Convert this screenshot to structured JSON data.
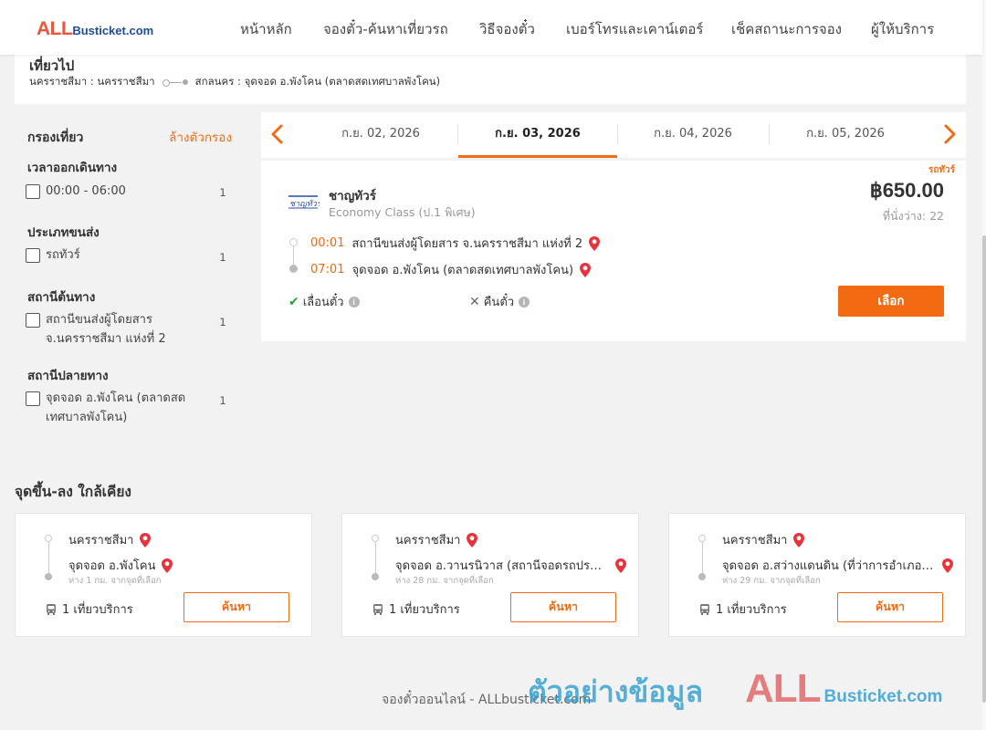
{
  "header": {
    "logo_all": "ALL",
    "logo_rest": "Busticket.com",
    "nav": [
      "หน้าหลัก",
      "จองตั๋ว-ค้นหาเที่ยวรถ",
      "วิธีจองตั๋ว",
      "เบอร์โทรและเคาน์เตอร์",
      "เช็คสถานะการจอง",
      "ผู้ให้บริการ"
    ]
  },
  "trip": {
    "title": "เที่ยวไป",
    "from": "นครราชสีมา : นครราชสีมา",
    "to": "สกลนคร : จุดจอด อ.พังโคน (ตลาดสดเทศบาลพังโคน)"
  },
  "filters": {
    "title": "กรองเที่ยว",
    "clear": "ล้างตัวกรอง",
    "groups": [
      {
        "title": "เวลาออกเดินทาง",
        "options": [
          {
            "label": "00:00 - 06:00",
            "count": "1",
            "checked": false
          }
        ]
      },
      {
        "title": "ประเภทขนส่ง",
        "options": [
          {
            "label": "รถทัวร์",
            "count": "1",
            "checked": false
          }
        ]
      },
      {
        "title": "สถานีต้นทาง",
        "options": [
          {
            "label": "สถานีขนส่งผู้โดยสาร จ.นครราชสีมา แห่งที่ 2",
            "count": "1",
            "checked": false
          }
        ]
      },
      {
        "title": "สถานีปลายทาง",
        "options": [
          {
            "label": "จุดจอด อ.พังโคน (ตลาดสดเทศบาลพังโคน)",
            "count": "1",
            "checked": false
          }
        ]
      }
    ]
  },
  "dates": {
    "tabs": [
      "ก.ย. 02, 2026",
      "ก.ย. 03, 2026",
      "ก.ย. 04, 2026",
      "ก.ย. 05, 2026"
    ],
    "active_index": 1
  },
  "result": {
    "tag": "รถทัวร์",
    "operator": "ชาญทัวร์",
    "class": "Economy Class (ป.1 พิเศษ)",
    "price": "฿650.00",
    "seats": "ที่นั่งว่าง: 22",
    "depart_time": "00:01",
    "depart_place": "สถานีขนส่งผู้โดยสาร จ.นครราชสีมา แห่งที่ 2",
    "arrive_time": "07:01",
    "arrive_place": "จุดจอด อ.พังโคน (ตลาดสดเทศบาลพังโคน)",
    "reschedule": "เลื่อนตั๋ว",
    "refund": "คืนตั๋ว",
    "select_label": "เลือก"
  },
  "nearby": {
    "title": "จุดขึ้น-ลง ใกล้เคียง",
    "cards": [
      {
        "from": "นครราชสีมา",
        "to": "จุดจอด อ.พังโคน",
        "distance": "ห่าง 1 กม. จากจุดที่เลือก",
        "trips": "1 เที่ยวบริการ",
        "button": "ค้นหา"
      },
      {
        "from": "นครราชสีมา",
        "to": "จุดจอด อ.วานรนิวาส (สถานีจอดรถประจำทาง)",
        "distance": "ห่าง 28 กม. จากจุดที่เลือก",
        "trips": "1 เที่ยวบริการ",
        "button": "ค้นหา"
      },
      {
        "from": "นครราชสีมา",
        "to": "จุดจอด อ.สว่างแดนดิน (ที่ว่าการอำเภอสว่างแดนดิน)",
        "distance": "ห่าง 29 กม. จากจุดที่เลือก",
        "trips": "1 เที่ยวบริการ",
        "button": "ค้นหา"
      }
    ]
  },
  "footer": {
    "text": "จองตั๋วออนไลน์ - ALLbusticket.com",
    "watermark_thai": "ตัวอย่างข้อมูล",
    "watermark_all": "ALL",
    "watermark_rest": "Busticket.com"
  },
  "colors": {
    "accent": "#f26b12",
    "pin": "#e8323c",
    "brand_blue": "#1e4c9a"
  }
}
